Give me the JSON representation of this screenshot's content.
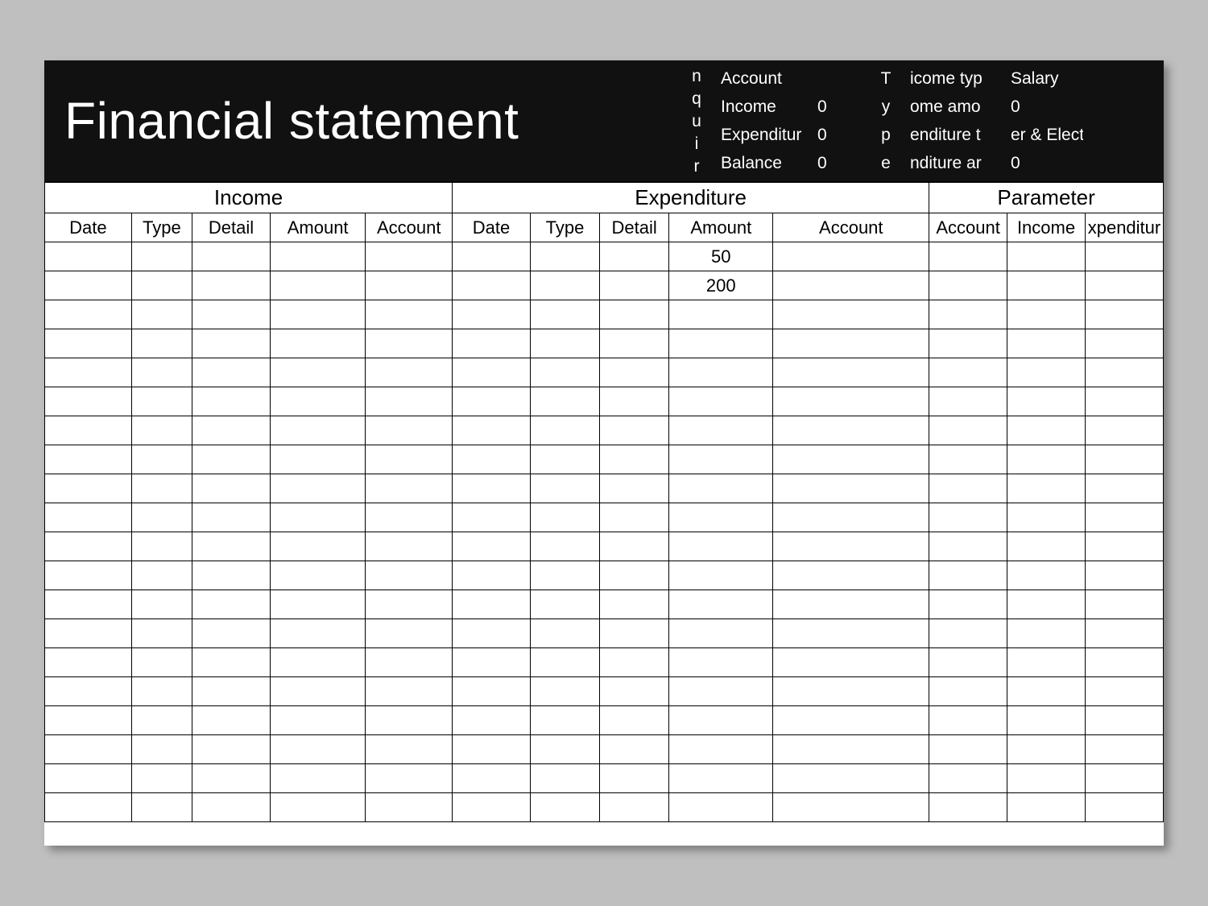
{
  "title": "Financial statement",
  "header_vertical_1": "n q u i r",
  "summary": {
    "account_label": "Account",
    "income_label": "Income",
    "income_value": "0",
    "expenditure_label": "Expenditur",
    "expenditure_value": "0",
    "balance_label": "Balance",
    "balance_value": "0"
  },
  "header_vertical_2": "T y p e",
  "summary2": {
    "r1l": "icome typ",
    "r1v": "Salary",
    "r2l": "ome amo",
    "r2v": "0",
    "r3l": "enditure t",
    "r3v": "er & Elect",
    "r4l": "nditure ar",
    "r4v": "0"
  },
  "sections": {
    "income": "Income",
    "expenditure": "Expenditure",
    "parameter": "Parameter"
  },
  "columns": {
    "income": [
      "Date",
      "Type",
      "Detail",
      "Amount",
      "Account"
    ],
    "expenditure": [
      "Date",
      "Type",
      "Detail",
      "Amount",
      "Account"
    ],
    "parameter": [
      "Account",
      "Income",
      "xpenditur"
    ]
  },
  "rows": [
    {
      "exp_amount": "50"
    },
    {
      "exp_amount": "200"
    },
    {},
    {},
    {},
    {},
    {},
    {},
    {},
    {},
    {},
    {},
    {},
    {},
    {},
    {},
    {},
    {},
    {},
    {}
  ]
}
